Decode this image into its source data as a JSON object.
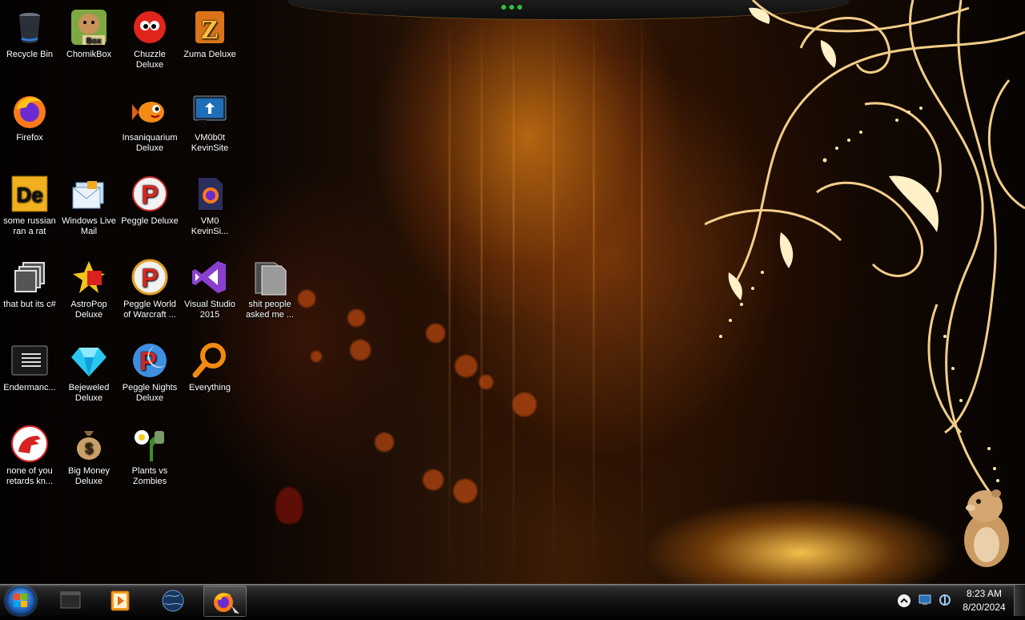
{
  "desktop": {
    "icons": [
      {
        "label": "Recycle Bin",
        "icon": "recycle-bin-icon"
      },
      {
        "label": "ChomikBox",
        "icon": "chomikbox-icon"
      },
      {
        "label": "Chuzzle Deluxe",
        "icon": "chuzzle-icon"
      },
      {
        "label": "Zuma Deluxe",
        "icon": "zuma-icon"
      },
      {
        "label": "Firefox",
        "icon": "firefox-icon"
      },
      {
        "label": "Insaniquarium Deluxe",
        "icon": "insaniquarium-icon"
      },
      {
        "label": "VM0b0t KevinSite",
        "icon": "vm-monitor-icon"
      },
      {
        "label": "some russian ran a rat",
        "icon": "de-file-icon"
      },
      {
        "label": "Windows Live Mail",
        "icon": "windows-live-mail-icon"
      },
      {
        "label": "Peggle Deluxe",
        "icon": "peggle-icon"
      },
      {
        "label": "VM0 KevinSi...",
        "icon": "firefox-file-icon"
      },
      {
        "label": "that but its c#",
        "icon": "copies-icon"
      },
      {
        "label": "AstroPop Deluxe",
        "icon": "astropop-icon"
      },
      {
        "label": "Peggle World of Warcraft ...",
        "icon": "peggle-wow-icon"
      },
      {
        "label": "Visual Studio 2015",
        "icon": "visual-studio-icon"
      },
      {
        "label": "shit people asked me ...",
        "icon": "folder-icon"
      },
      {
        "label": "Endermanc...",
        "icon": "console-icon"
      },
      {
        "label": "Bejeweled Deluxe",
        "icon": "bejeweled-icon"
      },
      {
        "label": "Peggle Nights Deluxe",
        "icon": "peggle-nights-icon"
      },
      {
        "label": "Everything",
        "icon": "everything-search-icon"
      },
      {
        "label": "none of you retards kn...",
        "icon": "dinosaur-icon"
      },
      {
        "label": "Big Money Deluxe",
        "icon": "money-bag-icon"
      },
      {
        "label": "Plants vs Zombies",
        "icon": "plants-vs-zombies-icon"
      }
    ]
  },
  "taskbar": {
    "start_button": "windows-start-icon",
    "pinned": [
      "window-icon",
      "media-player-icon",
      "globe-icon",
      "firefox-icon"
    ],
    "tray": [
      "show-hidden-icons-icon",
      "network-icon",
      "sound-icon"
    ],
    "clock": {
      "time": "8:23 AM",
      "date": "8/20/2024"
    }
  },
  "colors": {
    "accent": "#f0a030",
    "taskbar": "#141414"
  }
}
